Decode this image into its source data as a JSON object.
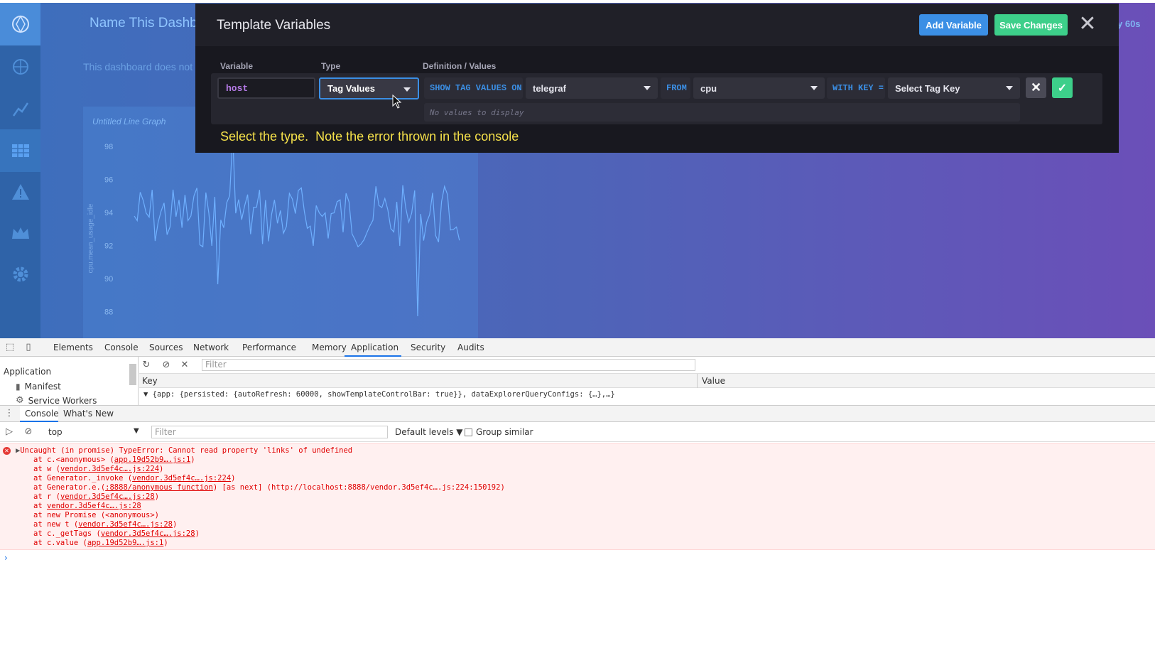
{
  "dashboard": {
    "title": "Name This Dashb",
    "empty_message": "This dashboard does not",
    "refresh_label": "y 60s",
    "graph": {
      "title": "Untitled Line Graph",
      "ylabel": "cpu.mean_usage_idle",
      "yticks": [
        "98",
        "96",
        "94",
        "92",
        "90",
        "88"
      ]
    }
  },
  "nav": {
    "items": [
      "logo",
      "data-explorer",
      "graph",
      "dashboards",
      "alerts",
      "admin",
      "settings"
    ]
  },
  "modal": {
    "title": "Template Variables",
    "add_variable": "Add Variable",
    "save_changes": "Save Changes",
    "close": "✕",
    "columns": {
      "variable": "Variable",
      "type": "Type",
      "definition": "Definition / Values"
    },
    "row": {
      "variable_value": "host",
      "type_value": "Tag Values",
      "show_tag_values_on": "SHOW TAG VALUES ON",
      "database": "telegraf",
      "from": "FROM",
      "measurement": "cpu",
      "with_key": "WITH KEY =",
      "tag_key_placeholder": "Select Tag Key",
      "no_values": "No values to display"
    },
    "annotation": "Select the type.  Note the error thrown in the console"
  },
  "devtools": {
    "tabs": [
      "Elements",
      "Console",
      "Sources",
      "Network",
      "Performance",
      "Memory",
      "Application",
      "Security",
      "Audits"
    ],
    "active_tab": "Application",
    "sidebar": {
      "heading": "Application",
      "items": [
        "Manifest",
        "Service Workers"
      ]
    },
    "storage": {
      "filter_placeholder": "Filter",
      "key_header": "Key",
      "value_header": "Value",
      "row": "▼ {app: {persisted: {autoRefresh: 60000, showTemplateControlBar: true}}, dataExplorerQueryConfigs: {…},…}"
    },
    "drawer_tabs": [
      "Console",
      "What's New"
    ],
    "console": {
      "context": "top",
      "filter_placeholder": "Filter",
      "levels": "Default levels ▼",
      "group_similar": "Group similar",
      "error": "Uncaught (in promise) TypeError: Cannot read property 'links' of undefined",
      "stack": [
        {
          "pre": "at c.<anonymous> (",
          "link": "app.19d52b9….js:1",
          "post": ")"
        },
        {
          "pre": "at w (",
          "link": "vendor.3d5ef4c….js:224",
          "post": ")"
        },
        {
          "pre": "at Generator._invoke (",
          "link": "vendor.3d5ef4c….js:224",
          "post": ")"
        },
        {
          "pre": "at Generator.e.(",
          "link": ":8888/anonymous function",
          "post": ") [as next] (http://localhost:8888/vendor.3d5ef4c….js:224:150192)"
        },
        {
          "pre": "at r (",
          "link": "vendor.3d5ef4c….js:28",
          "post": ")"
        },
        {
          "pre": "at ",
          "link": "vendor.3d5ef4c….js:28",
          "post": ""
        },
        {
          "pre": "at new Promise (<anonymous>)",
          "link": "",
          "post": ""
        },
        {
          "pre": "at new t (",
          "link": "vendor.3d5ef4c….js:28",
          "post": ")"
        },
        {
          "pre": "at c._getTags (",
          "link": "vendor.3d5ef4c….js:28",
          "post": ")"
        },
        {
          "pre": "at c.value (",
          "link": "app.19d52b9….js:1",
          "post": ")"
        }
      ]
    }
  }
}
